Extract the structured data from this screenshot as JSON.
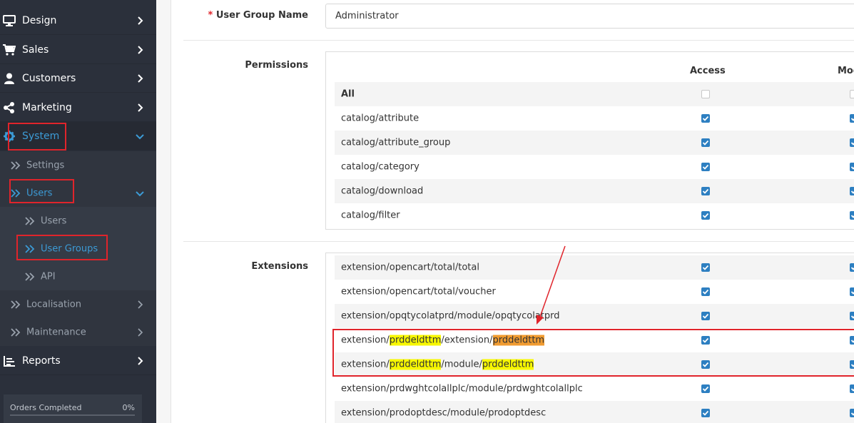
{
  "sidebar": {
    "items": [
      {
        "label": "Design",
        "icon": "monitor-icon"
      },
      {
        "label": "Sales",
        "icon": "cart-icon"
      },
      {
        "label": "Customers",
        "icon": "user-icon"
      },
      {
        "label": "Marketing",
        "icon": "share-icon"
      },
      {
        "label": "System",
        "icon": "cog-icon"
      },
      {
        "label": "Reports",
        "icon": "bar-chart-icon"
      }
    ],
    "system_children": {
      "settings": "Settings",
      "users": "Users",
      "users_children": [
        "Users",
        "User Groups",
        "API"
      ],
      "localisation": "Localisation",
      "maintenance": "Maintenance"
    },
    "orders": {
      "label": "Orders Completed",
      "percent": "0%",
      "progress": 0
    }
  },
  "form": {
    "group_name_label": "User Group Name",
    "required_marker": "*",
    "group_name_value": "Administrator",
    "permissions_label": "Permissions",
    "extensions_label": "Extensions",
    "col_access": "Access",
    "col_modify": "Modify"
  },
  "permissions": [
    {
      "name": "All",
      "access": false,
      "modify": false
    },
    {
      "name": "catalog/attribute",
      "access": true,
      "modify": true
    },
    {
      "name": "catalog/attribute_group",
      "access": true,
      "modify": true
    },
    {
      "name": "catalog/category",
      "access": true,
      "modify": true
    },
    {
      "name": "catalog/download",
      "access": true,
      "modify": true
    },
    {
      "name": "catalog/filter",
      "access": true,
      "modify": true
    }
  ],
  "extensions": [
    {
      "name": "extension/opencart/total/total",
      "access": true,
      "modify": true
    },
    {
      "name": "extension/opencart/total/voucher",
      "access": true,
      "modify": true
    },
    {
      "name": "extension/opqtycolatprd/module/opqtycolatprd",
      "access": true,
      "modify": true
    },
    {
      "parts": [
        "extension/",
        "prddeldttm",
        "/extension/",
        "prddeldttm"
      ],
      "access": true,
      "modify": true
    },
    {
      "parts": [
        "extension/",
        "prddeldttm",
        "/module/",
        "prddeldttm"
      ],
      "access": true,
      "modify": true
    },
    {
      "name": "extension/prdwghtcolallplc/module/prdwghtcolallplc",
      "access": true,
      "modify": true
    },
    {
      "name": "extension/prodoptdesc/module/prodoptdesc",
      "access": true,
      "modify": true
    }
  ],
  "colors": {
    "sidebar_bg": "#2b303b",
    "accent": "#3c9bd6",
    "checkbox": "#2d7fc1",
    "annotation_red": "#e0242b",
    "highlight_yellow": "#f7f701",
    "highlight_orange": "#f09b30"
  }
}
